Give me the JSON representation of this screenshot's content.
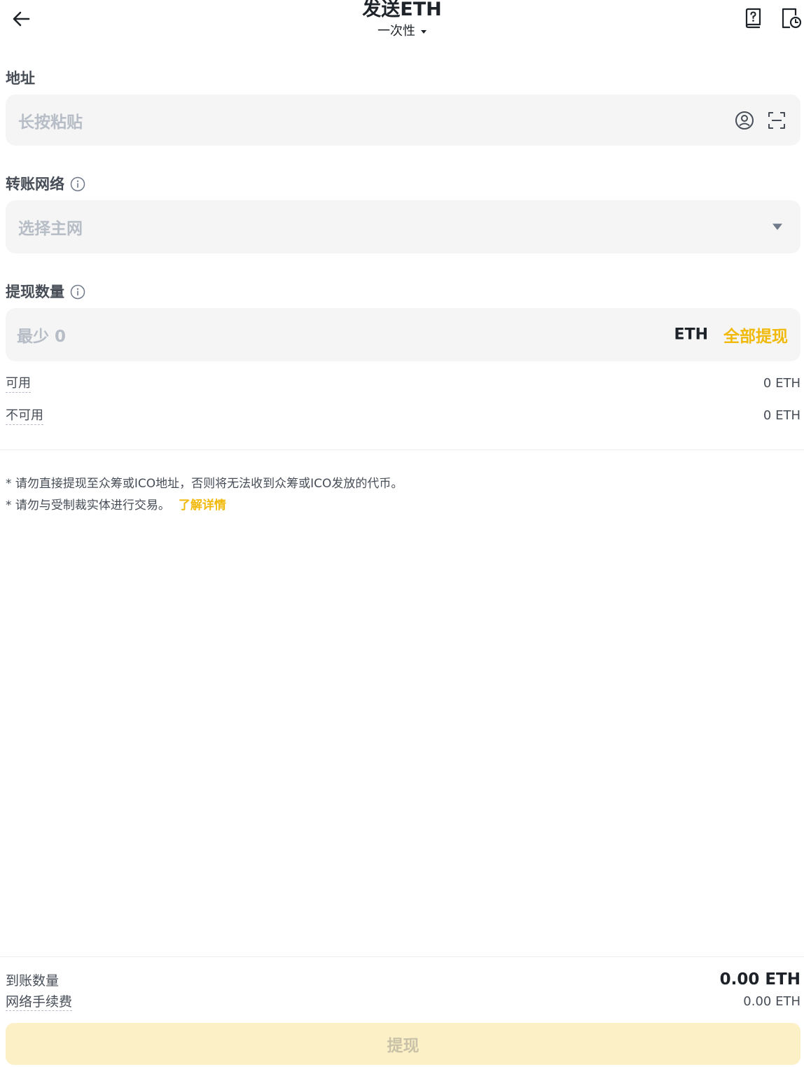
{
  "header": {
    "title": "发送ETH",
    "mode": "一次性",
    "icons": {
      "back": "arrow-left-icon",
      "help": "help-book-icon",
      "history": "history-document-icon"
    }
  },
  "address": {
    "label": "地址",
    "placeholder": "长按粘贴",
    "icons": [
      "address-book-icon",
      "scan-icon"
    ]
  },
  "network": {
    "label": "转账网络",
    "placeholder": "选择主网"
  },
  "amount": {
    "label": "提现数量",
    "placeholder": "最少 0",
    "unit": "ETH",
    "max_label": "全部提现"
  },
  "balances": [
    {
      "label": "可用",
      "value": "0 ETH"
    },
    {
      "label": "不可用",
      "value": "0 ETH"
    }
  ],
  "notes": {
    "line1": "* 请勿直接提现至众筹或ICO地址，否则将无法收到众筹或ICO发放的代币。",
    "line2": "* 请勿与受制裁实体进行交易。",
    "link": "了解详情"
  },
  "summary": {
    "received_label": "到账数量",
    "received_value": "0.00 ETH",
    "fee_label": "网络手续费",
    "fee_value": "0.00 ETH"
  },
  "submit_label": "提现",
  "colors": {
    "accent": "#f0b90b",
    "field_bg": "#f5f5f5",
    "button_disabled_bg": "#fcf0c6"
  }
}
